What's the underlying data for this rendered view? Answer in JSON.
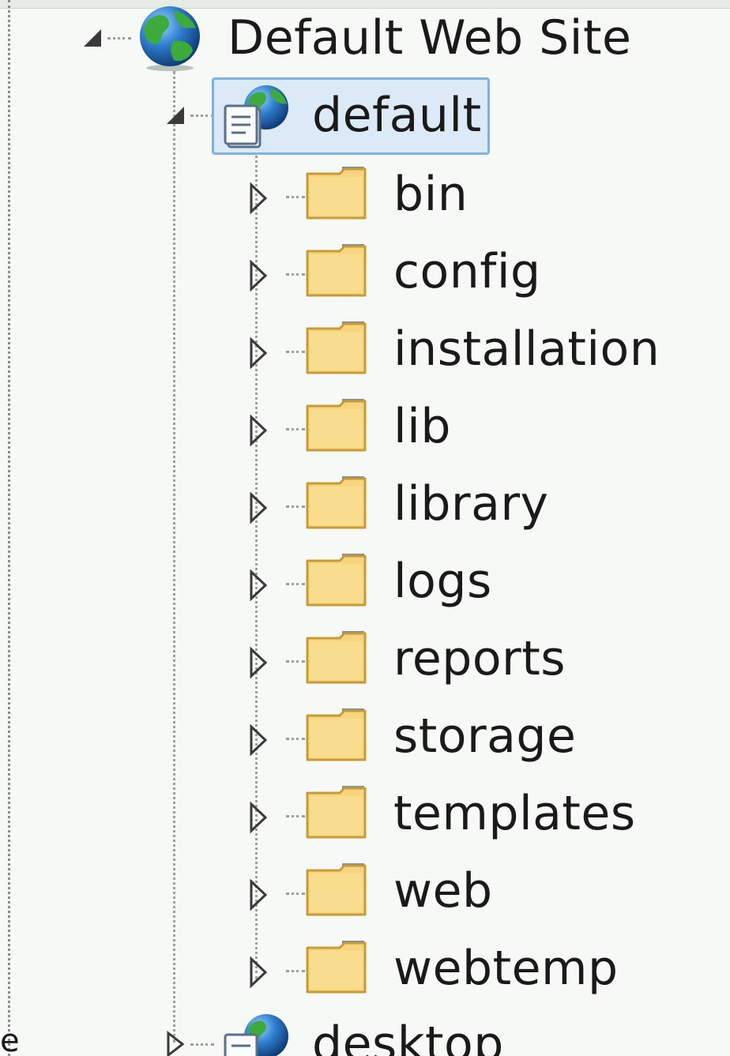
{
  "tree": {
    "root": {
      "label": "Default Web Site",
      "icon": "globe-icon",
      "expanded": true
    },
    "app": {
      "label": "default",
      "icon": "web-application-icon",
      "expanded": true,
      "selected": true
    },
    "folders": [
      {
        "label": "bin",
        "icon": "folder-icon",
        "expanded": false
      },
      {
        "label": "config",
        "icon": "folder-icon",
        "expanded": false
      },
      {
        "label": "installation",
        "icon": "folder-icon",
        "expanded": false
      },
      {
        "label": "lib",
        "icon": "folder-icon",
        "expanded": false
      },
      {
        "label": "library",
        "icon": "folder-icon",
        "expanded": false
      },
      {
        "label": "logs",
        "icon": "folder-icon",
        "expanded": false
      },
      {
        "label": "reports",
        "icon": "folder-icon",
        "expanded": false
      },
      {
        "label": "storage",
        "icon": "folder-icon",
        "expanded": false
      },
      {
        "label": "templates",
        "icon": "folder-icon",
        "expanded": false
      },
      {
        "label": "web",
        "icon": "folder-icon",
        "expanded": false
      },
      {
        "label": "webtemp",
        "icon": "folder-icon",
        "expanded": false
      }
    ],
    "sibling_app": {
      "label": "desktop",
      "icon": "web-application-icon",
      "expanded": false
    },
    "left_edge_text": "e"
  },
  "colors": {
    "background": "#f6f9f6",
    "selection_fill": "#dce9f7",
    "selection_border": "#7eb3e6",
    "folder_fill": "#f7d57e",
    "folder_edge": "#c99a35",
    "globe_blue": "#2f7fd0",
    "globe_green": "#3caa3c"
  }
}
